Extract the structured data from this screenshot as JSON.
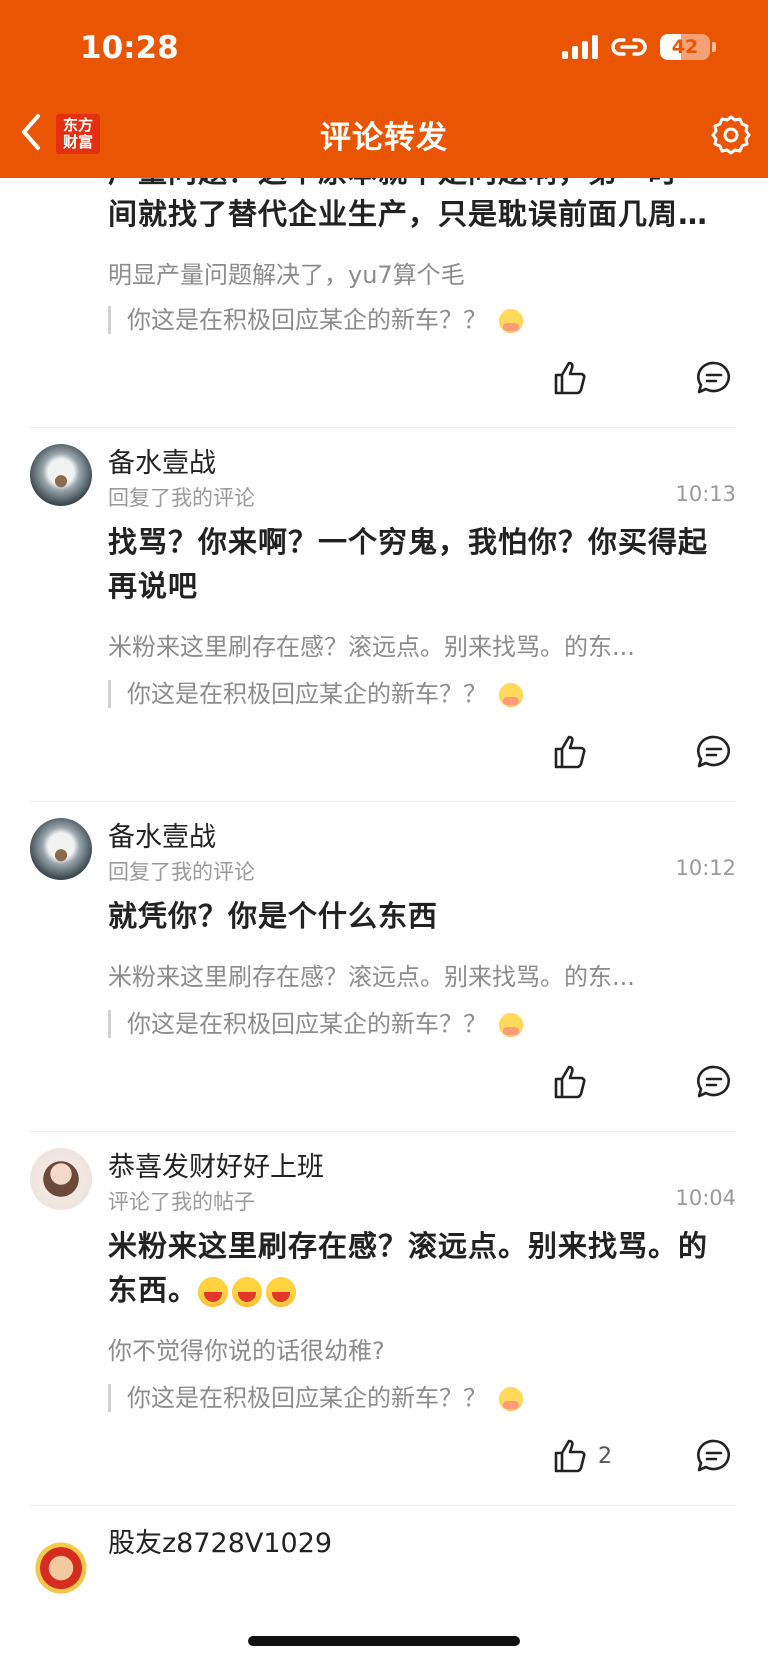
{
  "status_bar": {
    "time": "10:28",
    "battery": "42",
    "battery_level": 0.42
  },
  "header": {
    "logo_line1": "东方",
    "logo_line2": "财富",
    "title": "评论转发"
  },
  "partial_item": {
    "line1": "广量问题？这个原本就不是问题啊，第一时",
    "line2": "间就找了替代企业生产，只是耽误前面几周…",
    "ref": "明显产量问题解决了，yu7算个毛",
    "quote": "你这是在积极回应某企的新车？？"
  },
  "items": [
    {
      "username": "备水壹战",
      "action": "回复了我的评论",
      "time": "10:13",
      "body": "找骂？你来啊？一个穷鬼，我怕你？你买得起再说吧",
      "ref": "米粉来这里刷存在感？滚远点。别来找骂。的东...",
      "quote": "你这是在积极回应某企的新车？？"
    },
    {
      "username": "备水壹战",
      "action": "回复了我的评论",
      "time": "10:12",
      "body": "就凭你？你是个什么东西",
      "ref": "米粉来这里刷存在感？滚远点。别来找骂。的东...",
      "quote": "你这是在积极回应某企的新车？？"
    },
    {
      "username": "恭喜发财好好上班",
      "action": "评论了我的帖子",
      "time": "10:04",
      "body": "米粉来这里刷存在感？滚远点。别来找骂。的东西。",
      "ref": "你不觉得你说的话很幼稚?",
      "quote": "你这是在积极回应某企的新车？？",
      "likes": "2"
    }
  ],
  "last_item": {
    "username": "股友z8728V1029"
  },
  "icons": {
    "back": "chevron-left-icon",
    "settings": "gear-icon",
    "like": "thumbs-up-icon",
    "reply": "comment-icon"
  },
  "colors": {
    "brand": "#ea5504",
    "logo_red": "#e43011"
  }
}
